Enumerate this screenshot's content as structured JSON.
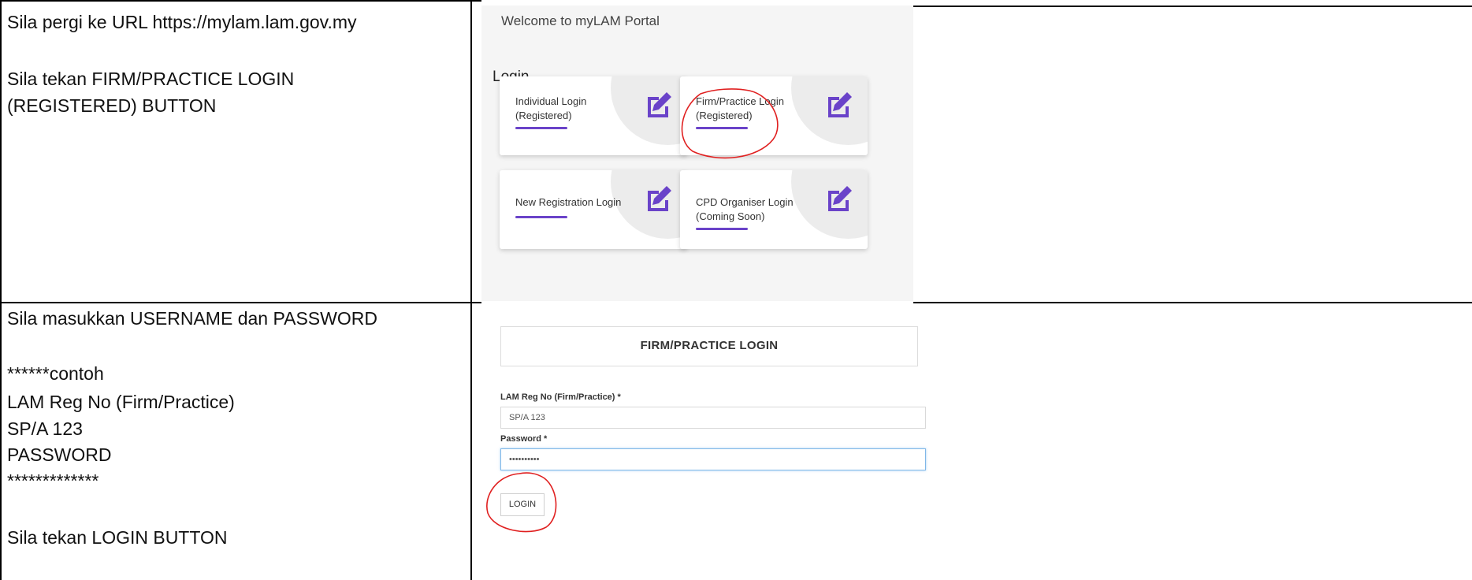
{
  "instructions": {
    "step1_line1": "Sila pergi ke URL https://mylam.lam.gov.my",
    "step1_line2": "Sila tekan FIRM/PRACTICE LOGIN",
    "step1_line3": "(REGISTERED) BUTTON",
    "step2_line1": "Sila masukkan USERNAME dan PASSWORD",
    "step2_line2": "******contoh",
    "step2_line3": "LAM Reg No (Firm/Practice)",
    "step2_line4": "SP/A 123",
    "step2_line5": "PASSWORD",
    "step2_line6": "*************",
    "step2_line7": "Sila tekan LOGIN BUTTON"
  },
  "portal": {
    "welcome": "Welcome to myLAM Portal",
    "login_heading": "Login",
    "cards": [
      {
        "line1": "Individual Login",
        "line2": "(Registered)",
        "icon": "edit-icon"
      },
      {
        "line1": "Firm/Practice Login",
        "line2": "(Registered)",
        "icon": "edit-icon"
      },
      {
        "line1": "New Registration Login",
        "line2": "",
        "icon": "edit-icon"
      },
      {
        "line1": "CPD Organiser Login",
        "line2": "(Coming Soon)",
        "icon": "edit-icon"
      }
    ]
  },
  "firm_login": {
    "title": "FIRM/PRACTICE LOGIN",
    "reg_label": "LAM Reg No (Firm/Practice) *",
    "reg_value": "SP/A 123",
    "password_label": "Password *",
    "password_value": "••••••••••",
    "login_label": "LOGIN"
  },
  "colors": {
    "accent": "#6a43c9",
    "annotation": "#e02020"
  }
}
